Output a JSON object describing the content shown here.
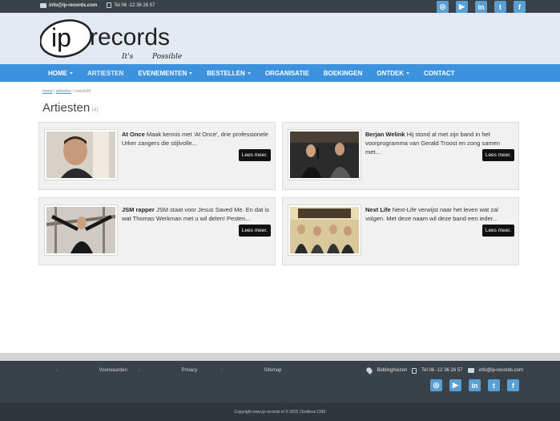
{
  "topbar": {
    "email": "info@ip-records.com",
    "phone": "Tel 06 -12 36 26 57"
  },
  "social": {
    "icons": [
      "instagram-icon",
      "youtube-icon",
      "linkedin-icon",
      "twitter-icon",
      "facebook-icon"
    ],
    "glyphs": [
      "◎",
      "▶",
      "in",
      "t",
      "f"
    ]
  },
  "logo": {
    "brand_ip": "ip",
    "brand_records": "records",
    "tagline_1": "It's",
    "tagline_2": "Possible"
  },
  "nav": {
    "items": [
      {
        "label": "HOME",
        "caret": true
      },
      {
        "label": "ARTIESTEN",
        "caret": false
      },
      {
        "label": "EVENEMENTEN",
        "caret": true
      },
      {
        "label": "BESTELLEN",
        "caret": true
      },
      {
        "label": "ORGANISATIE",
        "caret": false
      },
      {
        "label": "BOEKINGEN",
        "caret": false
      },
      {
        "label": "ONTDEK",
        "caret": true
      },
      {
        "label": "CONTACT",
        "caret": false
      }
    ]
  },
  "breadcrumb": {
    "home": "home",
    "artiesten": "artiesten",
    "current": "overzicht",
    "sep": " / "
  },
  "page": {
    "title": "Artiesten",
    "count": "(4)"
  },
  "cards": [
    {
      "name": "At Once",
      "text": "Maak kennis met 'At Once', drie professionele Urker zangers die stijlvolle...",
      "more": "Lees meer."
    },
    {
      "name": "Berjan Welink",
      "text": "Hij stond al met zijn band in het voorprogramma van Gerald Troost en zong samen met...",
      "more": "Lees meer."
    },
    {
      "name": "JSM rapper",
      "text": "JSM staat voor Jesus Saved Me. En dat is wat Thomas Werkman met u wil delen! Pesten...",
      "more": "Lees meer."
    },
    {
      "name": "Next Life",
      "text": "Next-Life verwijst naar het leven wat zal volgen. Met deze naam wil deze band een ieder...",
      "more": "Lees meer."
    }
  ],
  "footer": {
    "links": [
      "Voorwaarden",
      "Privacy",
      "Sitemap"
    ],
    "location": "Biddinghuizen",
    "phone": "Tel 06 -12 36 26 57",
    "email": "info@ip-records.com",
    "copyright": "Copyright www.ip-records.nl © 2015 | Endless CMS"
  },
  "colors": {
    "nav": "#3c92dc",
    "topbar": "#3a4249",
    "social": "#5a9fd4",
    "button": "#111111"
  }
}
